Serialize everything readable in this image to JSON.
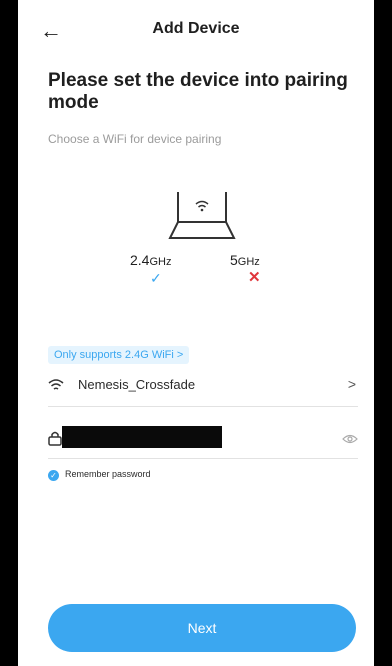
{
  "header": {
    "back_icon": "arrow-left-icon",
    "title": "Add Device"
  },
  "main": {
    "heading": "Please set the device into pairing mode",
    "subtitle": "Choose a WiFi for device pairing",
    "bands": [
      {
        "label": "2.4",
        "unit": "GHz",
        "status": "✓",
        "status_icon": "check-icon",
        "color": "#3ba7f0"
      },
      {
        "label": "5",
        "unit": "GHz",
        "status": "✕",
        "status_icon": "cross-icon",
        "color": "#e0363b"
      }
    ],
    "supports_label": "Only supports 2.4G WiFi >",
    "wifi": {
      "icon": "wifi-icon",
      "name": "Nemesis_Crossfade",
      "chevron": ">"
    },
    "password": {
      "icon": "lock-icon",
      "visibility_icon": "eye-icon"
    },
    "remember": {
      "checked": true,
      "label": "Remember password"
    }
  },
  "footer": {
    "next_label": "Next"
  },
  "colors": {
    "accent": "#3ba7f0",
    "error": "#e0363b"
  }
}
